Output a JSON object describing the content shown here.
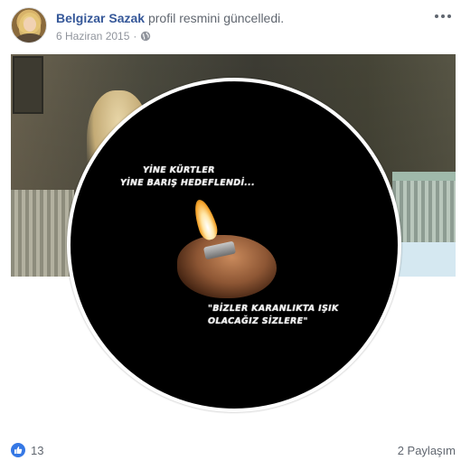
{
  "post": {
    "author_name": "Belgizar Sazak",
    "action_text": "profil resmini güncelledi.",
    "date": "6 Haziran 2015",
    "separator": "·",
    "privacy_icon": "globe-icon",
    "more_icon": "more-options-icon"
  },
  "image_text": {
    "line1": "YİNE KÜRTLER",
    "line2": "YİNE BARIŞ  HEDEFLENDİ...",
    "line3": "\"BİZLER KARANLIKTA IŞIK",
    "line4": "OLACAĞIZ  SİZLERE\""
  },
  "footer": {
    "like_icon": "like-icon",
    "like_count": "13",
    "share_text": "2 Paylaşım"
  },
  "colors": {
    "author": "#365899",
    "secondary_text": "#616770",
    "like_blue": "#3578e5"
  }
}
